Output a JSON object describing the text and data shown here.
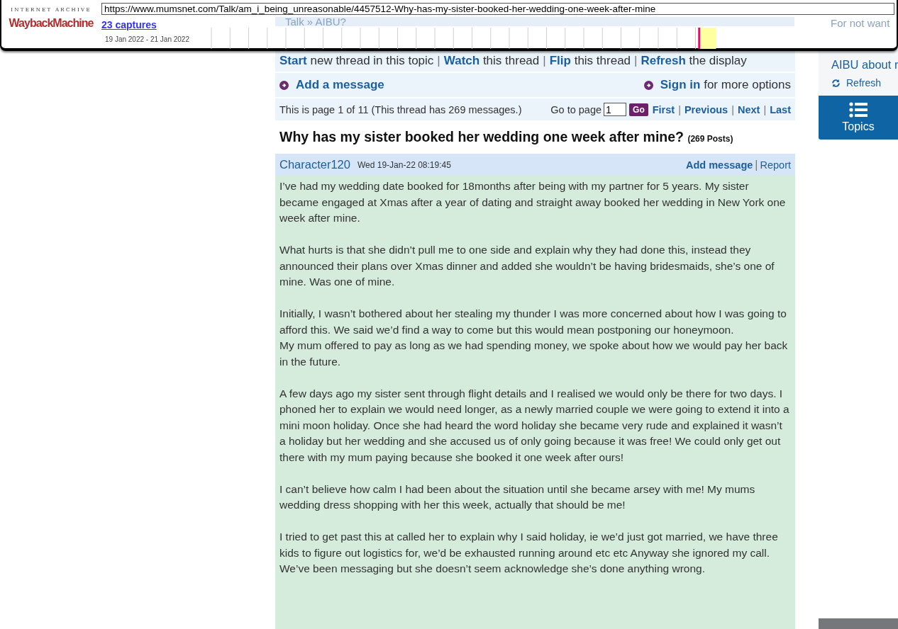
{
  "wayback": {
    "logo_top": "INTERNET ARCHIVE",
    "logo_main": "WaybackMachine",
    "url": "https://www.mumsnet.com/Talk/am_i_being_unreasonable/4457512-Why-has-my-sister-booked-her-wedding-one-week-after-mine",
    "captures": "23 captures",
    "date_range": "19 Jan 2022 - 21 Jan 2022",
    "ghost_breadcrumb": "Talk » AIBU?",
    "ghost_sidebar": "For not want"
  },
  "thread_actions": [
    {
      "link": "Start",
      "text": "new thread in this topic"
    },
    {
      "link": "Watch",
      "text": "this thread"
    },
    {
      "link": "Flip",
      "text": "this thread"
    },
    {
      "link": "Refresh",
      "text": "the display"
    }
  ],
  "separator": "|",
  "add_message": "Add a message",
  "sign_in": {
    "link": "Sign in",
    "text": "for more options"
  },
  "paging": {
    "info": "This is page 1 of 11 (This thread has 269 messages.)",
    "goto_label": "Go to page",
    "page_value": "1",
    "go": "Go",
    "links": [
      "First",
      "Previous",
      "Next",
      "Last"
    ]
  },
  "thread": {
    "title": "Why has my sister booked her wedding one week after mine?",
    "count": "(269 Posts)"
  },
  "post": {
    "author": "Character120",
    "date": "Wed 19-Jan-22 08:19:45",
    "actions": [
      "Add message",
      "Report"
    ],
    "paragraphs": [
      [
        "I’ve had my wedding date booked for 18months after being with my partner for 5 years. My sister became engaged at Xmas after a year of dating and straight away booked her wedding in New York one week after mine."
      ],
      [
        "What hurts is that she didn’t pull me to one side and explain why they had done this, instead they announced their plans over Xmas dinner and added she wouldn’t be having bridesmaids, she’s one of mine. Was one of mine."
      ],
      [
        "Initially, I wasn’t bothered about her stealing my thunder I was more concerned about how I was going to afford this. We said we’d find a way to come but this would mean postponing our honeymoon.",
        "My mum offered to pay as long as we had spending money, we spoke about how we would pay her back in the future."
      ],
      [
        "A few days ago my sister sent through flight details and I realised we would only be there for two days. I phoned her to explain we would need longer, as a newly married couple we were going to extend it into a mini moon holiday. Once she had heard the word holiday she became very rude and explained it wasn’t a holiday but her wedding and she accused us of only going because it was free! We could only get out there with my mum paying because she booked it one week after ours!"
      ],
      [
        "I can’t believe how calm I had been about the situation until she became arsey with me! My mums wedding dress shopping with her this week, actually that should be me!"
      ],
      [
        "I tried to get past this at called her to explain why I said holiday, ie we’d just got married, we have three kids to figure out logistics for, we’d be exhausted running around etc etc Anyway she ignored my call. We’ve been messaging but she doesn’t seem acknowledge she’s done anything wrong."
      ]
    ]
  },
  "sidebar": {
    "link": "AIBU about r",
    "refresh": "Refresh",
    "topics": "Topics"
  }
}
